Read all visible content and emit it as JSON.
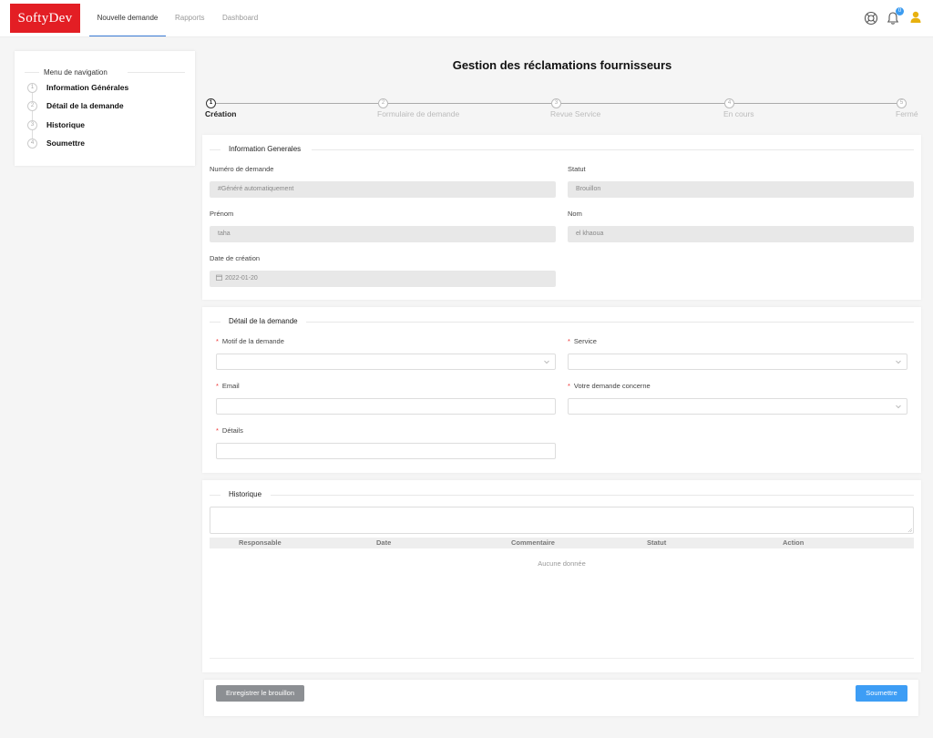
{
  "app": {
    "logo": "SoftyDev",
    "nav": [
      "Nouvelle demande",
      "Rapports",
      "Dashboard"
    ],
    "notification_count": "0",
    "accent_color": "#e31e24",
    "primary_color": "#3d9df5"
  },
  "sidebar": {
    "title": "Menu de navigation",
    "items": [
      {
        "num": "1",
        "label": "Information Générales"
      },
      {
        "num": "2",
        "label": "Détail de la demande"
      },
      {
        "num": "3",
        "label": "Historique"
      },
      {
        "num": "4",
        "label": "Soumettre"
      }
    ]
  },
  "page": {
    "title": "Gestion des réclamations fournisseurs"
  },
  "steps": [
    {
      "num": "1",
      "label": "Création"
    },
    {
      "num": "2",
      "label": "Formulaire de demande"
    },
    {
      "num": "3",
      "label": "Revue Service"
    },
    {
      "num": "4",
      "label": "En cours"
    },
    {
      "num": "5",
      "label": "Fermé"
    }
  ],
  "info": {
    "legend": "Information Generales",
    "numero_label": "Numéro de demande",
    "numero_value": "#Généré automatiquement",
    "statut_label": "Statut",
    "statut_value": "Brouillon",
    "prenom_label": "Prénom",
    "prenom_value": "taha",
    "nom_label": "Nom",
    "nom_value": "el khaoua",
    "date_label": "Date de création",
    "date_value": "2022-01-20"
  },
  "detail": {
    "legend": "Détail de la demande",
    "motif_label": "Motif de la demande",
    "service_label": "Service",
    "email_label": "Email",
    "concerne_label": "Votre demande concerne",
    "details_label": "Détails"
  },
  "historique": {
    "legend": "Historique",
    "columns": [
      "Responsable",
      "Date",
      "Commentaire",
      "Statut",
      "Action"
    ],
    "empty_text": "Aucune donnée"
  },
  "footer": {
    "draft_label": "Enregistrer le brouillon",
    "submit_label": "Soumettre"
  }
}
